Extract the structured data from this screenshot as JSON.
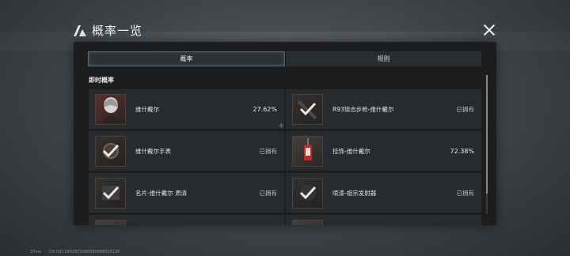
{
  "header": {
    "title": "概率一览"
  },
  "tabs": [
    {
      "label": "概率",
      "active": true
    },
    {
      "label": "规则",
      "active": false
    }
  ],
  "section": {
    "title": "即时概率"
  },
  "items": [
    {
      "name": "维什戴尔",
      "value": "27.62%",
      "owned": false,
      "icon": "character-portrait-icon"
    },
    {
      "name": "R93狙击步枪-维什戴尔",
      "value": "已拥有",
      "owned": true,
      "icon": "sniper-rifle-icon"
    },
    {
      "name": "维什戴尔手表",
      "value": "已拥有",
      "owned": true,
      "icon": "watch-icon"
    },
    {
      "name": "挂饰-维什戴尔",
      "value": "72.38%",
      "owned": false,
      "icon": "charm-icon"
    },
    {
      "name": "名片-维什戴尔 肃清",
      "value": "已拥有",
      "owned": true,
      "icon": "name-card-icon"
    },
    {
      "name": "喷漆-祖宗发射器",
      "value": "已拥有",
      "owned": true,
      "icon": "spray-icon"
    },
    {
      "name": "",
      "value": "",
      "owned": false,
      "icon": "item-icon"
    },
    {
      "name": "",
      "value": "",
      "owned": false,
      "icon": "item-icon"
    }
  ],
  "status": {
    "ping": "37ms",
    "uid": "CN UID:1942601098380648525128"
  }
}
